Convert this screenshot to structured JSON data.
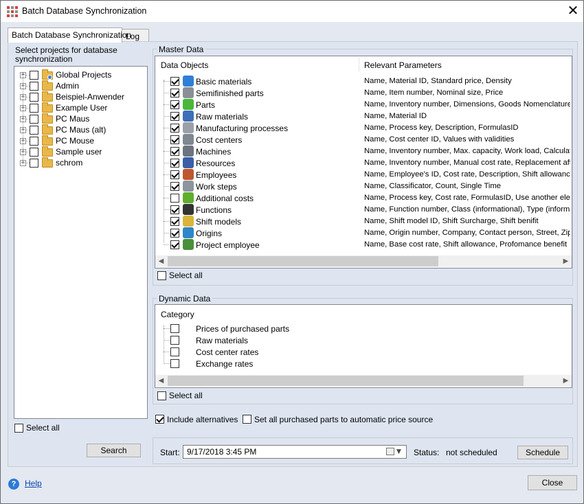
{
  "window": {
    "title": "Batch Database Synchronization",
    "close_glyph": "✕"
  },
  "tabs": [
    {
      "label": "Batch Database Synchronization",
      "active": true
    },
    {
      "label": "Log",
      "active": false
    }
  ],
  "projects": {
    "heading": "Select projects for database synchronization",
    "items": [
      {
        "label": "Global Projects",
        "badge": true
      },
      {
        "label": "Admin",
        "badge": false
      },
      {
        "label": "Beispiel-Anwender",
        "badge": false
      },
      {
        "label": "Example User",
        "badge": false
      },
      {
        "label": "PC Maus",
        "badge": false
      },
      {
        "label": "PC Maus (alt)",
        "badge": false
      },
      {
        "label": "PC Mouse",
        "badge": false
      },
      {
        "label": "Sample user",
        "badge": false
      },
      {
        "label": "schrom",
        "badge": false
      }
    ],
    "select_all": "Select all",
    "search_button": "Search"
  },
  "master": {
    "group_title": "Master Data",
    "col_objects": "Data Objects",
    "col_params": "Relevant Parameters",
    "rows": [
      {
        "name": "Basic materials",
        "checked": true,
        "icon": "cube-icon",
        "color": "#2f7fd8",
        "params": "Name, Material ID, Standard price, Density"
      },
      {
        "name": "Semifinished parts",
        "checked": true,
        "icon": "bar-stock-icon",
        "color": "#8a8f96",
        "params": "Name, Item number, Nominal size, Price"
      },
      {
        "name": "Parts",
        "checked": true,
        "icon": "green-cube-icon",
        "color": "#49b83a",
        "params": "Name, Inventory number, Dimensions, Goods Nomenclature Coc"
      },
      {
        "name": "Raw materials",
        "checked": true,
        "icon": "raw-material-icon",
        "color": "#3d6fb8",
        "params": "Name, Material ID"
      },
      {
        "name": "Manufacturing processes",
        "checked": true,
        "icon": "gears-icon",
        "color": "#9aa0a8",
        "params": "Name, Process key, Description, FormulasID"
      },
      {
        "name": "Cost centers",
        "checked": true,
        "icon": "calculator-icon",
        "color": "#7f8790",
        "params": "Name, Cost center ID, Values with validities"
      },
      {
        "name": "Machines",
        "checked": true,
        "icon": "machine-icon",
        "color": "#6b7480",
        "params": "Name, Inventory number, Max. capacity, Work load, Calculated"
      },
      {
        "name": "Resources",
        "checked": true,
        "icon": "tools-icon",
        "color": "#3a5fa8",
        "params": "Name, Inventory number, Manual cost rate, Replacement after p"
      },
      {
        "name": "Employees",
        "checked": true,
        "icon": "employee-icon",
        "color": "#c0562e",
        "params": "Name, Employee's ID, Cost rate, Description, Shift allowance, Pr"
      },
      {
        "name": "Work steps",
        "checked": true,
        "icon": "footsteps-icon",
        "color": "#8d959e",
        "params": "Name, Classificator, Count, Single Time"
      },
      {
        "name": "Additional costs",
        "checked": false,
        "icon": "gear-green-icon",
        "color": "#5fae2e",
        "params": "Name, Process key, Cost rate, FormulasID, Use another element"
      },
      {
        "name": "Functions",
        "checked": true,
        "icon": "function-icon",
        "color": "#333333",
        "params": "Name, Function number, Class (informational), Type (informationa"
      },
      {
        "name": "Shift models",
        "checked": true,
        "icon": "clock-icon",
        "color": "#d9b53a",
        "params": "Name, Shift model ID, Shift Surcharge, Shift benifit"
      },
      {
        "name": "Origins",
        "checked": true,
        "icon": "globe-icon",
        "color": "#2f86c9",
        "params": "Name, Origin number, Company, Contact person, Street, Zip Coc"
      },
      {
        "name": "Project employee",
        "checked": true,
        "icon": "project-employee-icon",
        "color": "#4a8f3a",
        "params": "Name, Base cost rate, Shift allowance, Profomance benefit"
      }
    ],
    "select_all": "Select all"
  },
  "dynamic": {
    "group_title": "Dynamic Data",
    "col_category": "Category",
    "rows": [
      {
        "name": "Prices of purchased parts",
        "checked": false
      },
      {
        "name": "Raw materials",
        "checked": false
      },
      {
        "name": "Cost center rates",
        "checked": false
      },
      {
        "name": "Exchange rates",
        "checked": false
      }
    ],
    "select_all": "Select all"
  },
  "options": {
    "include_alternatives": {
      "label": "Include alternatives",
      "checked": true
    },
    "auto_price_source": {
      "label": "Set all purchased parts to automatic price source",
      "checked": false
    }
  },
  "schedule": {
    "start_label": "Start:",
    "start_value": "9/17/2018   3:45 PM",
    "status_label": "Status:",
    "status_value": "not scheduled",
    "schedule_button": "Schedule"
  },
  "footer": {
    "help_label": "Help",
    "help_glyph": "?",
    "close_button": "Close"
  }
}
